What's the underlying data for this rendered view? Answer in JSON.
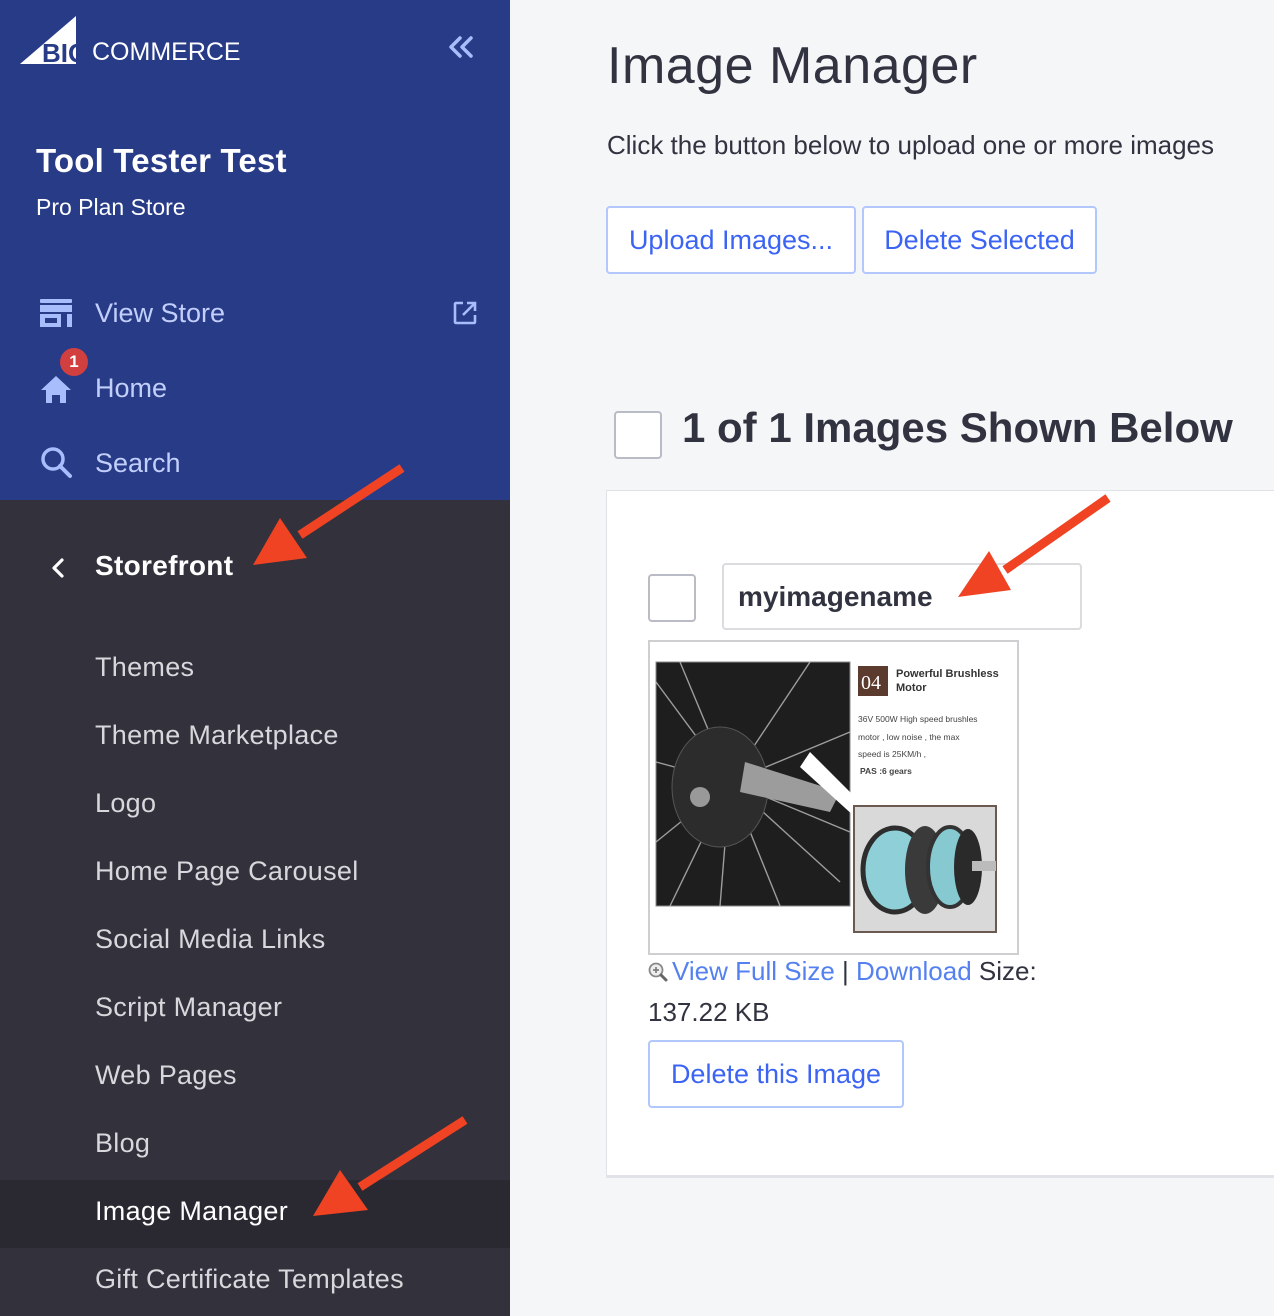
{
  "brand": {
    "logo_text_big": "BIG",
    "logo_text_rest": "COMMERCE"
  },
  "store": {
    "name": "Tool Tester Test",
    "plan": "Pro Plan Store"
  },
  "sidebar": {
    "collapse_icon": "double-chevron-left-icon",
    "top_items": [
      {
        "label": "View Store",
        "icon": "storefront-icon",
        "external": true
      },
      {
        "label": "Home",
        "icon": "home-icon",
        "badge": "1"
      },
      {
        "label": "Search",
        "icon": "search-icon"
      }
    ],
    "section": {
      "label": "Storefront",
      "icon": "chevron-left-icon"
    },
    "sub_items": [
      {
        "label": "Themes"
      },
      {
        "label": "Theme Marketplace"
      },
      {
        "label": "Logo"
      },
      {
        "label": "Home Page Carousel"
      },
      {
        "label": "Social Media Links"
      },
      {
        "label": "Script Manager"
      },
      {
        "label": "Web Pages"
      },
      {
        "label": "Blog"
      },
      {
        "label": "Image Manager",
        "active": true
      },
      {
        "label": "Gift Certificate Templates"
      }
    ]
  },
  "main": {
    "title": "Image Manager",
    "intro": "Click the button below to upload one or more images",
    "buttons": {
      "upload": "Upload Images...",
      "delete_selected": "Delete Selected"
    },
    "count_heading": "1 of 1 Images Shown Below",
    "images": [
      {
        "name": "myimagename",
        "thumbnail": {
          "badge_number": "04",
          "headline": "Powerful Brushless Motor",
          "description": [
            "36V 500W High speed brushles",
            "motor , low noise , the max",
            "speed is 25KM/h ,"
          ],
          "footnote": "PAS :6 gears"
        },
        "view_full_size": "View Full Size",
        "separator": "|",
        "download": "Download",
        "size_label": "Size:",
        "size_value": "137.22 KB",
        "delete_label": "Delete this Image"
      }
    ]
  },
  "colors": {
    "sidebar_top": "#283b87",
    "sidebar_bottom": "#32313c",
    "accent": "#3c64f4",
    "annotation_arrow": "#f04323",
    "badge": "#d23f3f"
  }
}
